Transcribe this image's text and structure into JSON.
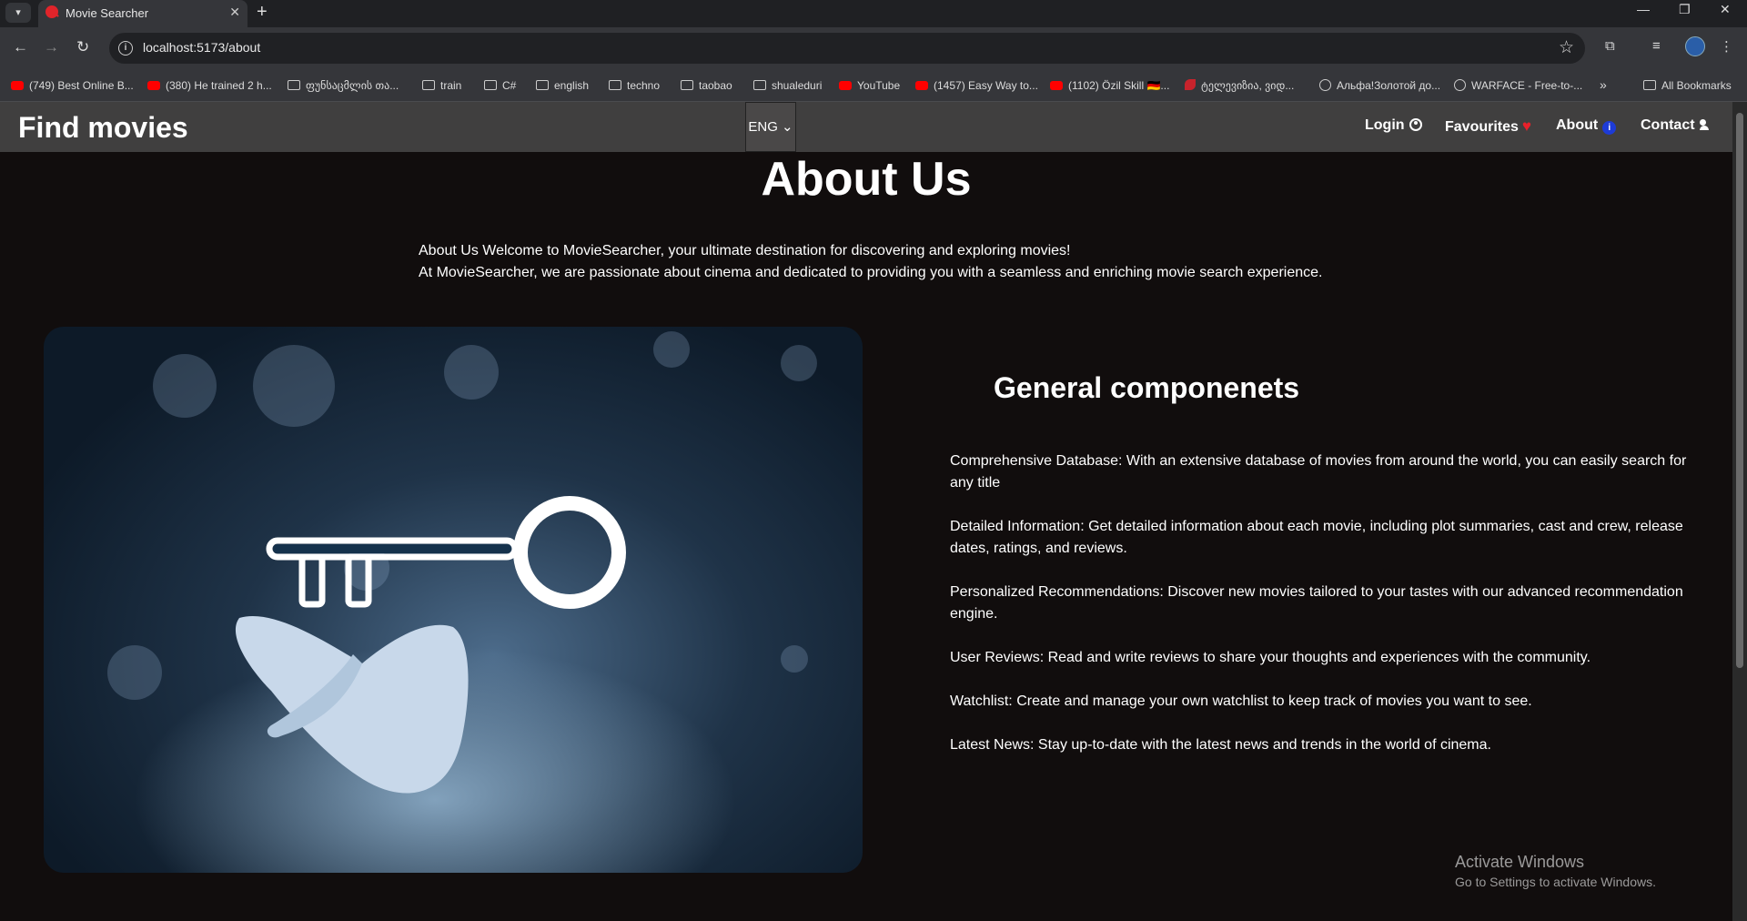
{
  "browser": {
    "tab_title": "Movie Searcher",
    "url": "localhost:5173/about",
    "bookmarks": [
      {
        "label": "(749) Best Online B...",
        "icon": "youtube-icon"
      },
      {
        "label": "(380) He trained 2 h...",
        "icon": "youtube-icon"
      },
      {
        "label": "ფუნსაცმლის თა...",
        "icon": "folder-icon"
      },
      {
        "label": "train",
        "icon": "folder-icon"
      },
      {
        "label": "C#",
        "icon": "folder-icon"
      },
      {
        "label": "english",
        "icon": "folder-icon"
      },
      {
        "label": "techno",
        "icon": "folder-icon"
      },
      {
        "label": "taobao",
        "icon": "folder-icon"
      },
      {
        "label": "shualeduri",
        "icon": "folder-icon"
      },
      {
        "label": "YouTube",
        "icon": "youtube-icon"
      },
      {
        "label": "(1457) Easy Way to...",
        "icon": "youtube-icon"
      },
      {
        "label": "(1102) Özil Skill 🇩🇪...",
        "icon": "youtube-icon"
      },
      {
        "label": "ტელევიზია, ვიდ...",
        "icon": "site-icon"
      },
      {
        "label": "Альфа!Золотой до...",
        "icon": "globe-icon"
      },
      {
        "label": "WARFACE - Free-to-...",
        "icon": "globe-icon"
      }
    ],
    "all_bookmarks": "All Bookmarks"
  },
  "site": {
    "brand": "Find movies",
    "language": "ENG",
    "nav": {
      "login": "Login",
      "favourites": "Favourites",
      "about": "About",
      "contact": "Contact"
    }
  },
  "about": {
    "title": "About Us",
    "intro_line1": "About Us Welcome to MovieSearcher, your ultimate destination for discovering and exploring movies!",
    "intro_line2": "At MovieSearcher, we are passionate about cinema and dedicated to providing you with a seamless and enriching movie search experience."
  },
  "components": {
    "title": "General componenets",
    "items": [
      "Comprehensive Database: With an extensive database of movies from around the world, you can easily search for any title",
      "Detailed Information: Get detailed information about each movie, including plot summaries, cast and crew, release dates, ratings, and reviews.",
      "Personalized Recommendations: Discover new movies tailored to your tastes with our advanced recommendation engine.",
      "User Reviews: Read and write reviews to share your thoughts and experiences with the community.",
      "Watchlist: Create and manage your own watchlist to keep track of movies you want to see.",
      "Latest News: Stay up-to-date with the latest news and trends in the world of cinema."
    ]
  },
  "os_watermark": {
    "line1": "Activate Windows",
    "line2": "Go to Settings to activate Windows."
  }
}
